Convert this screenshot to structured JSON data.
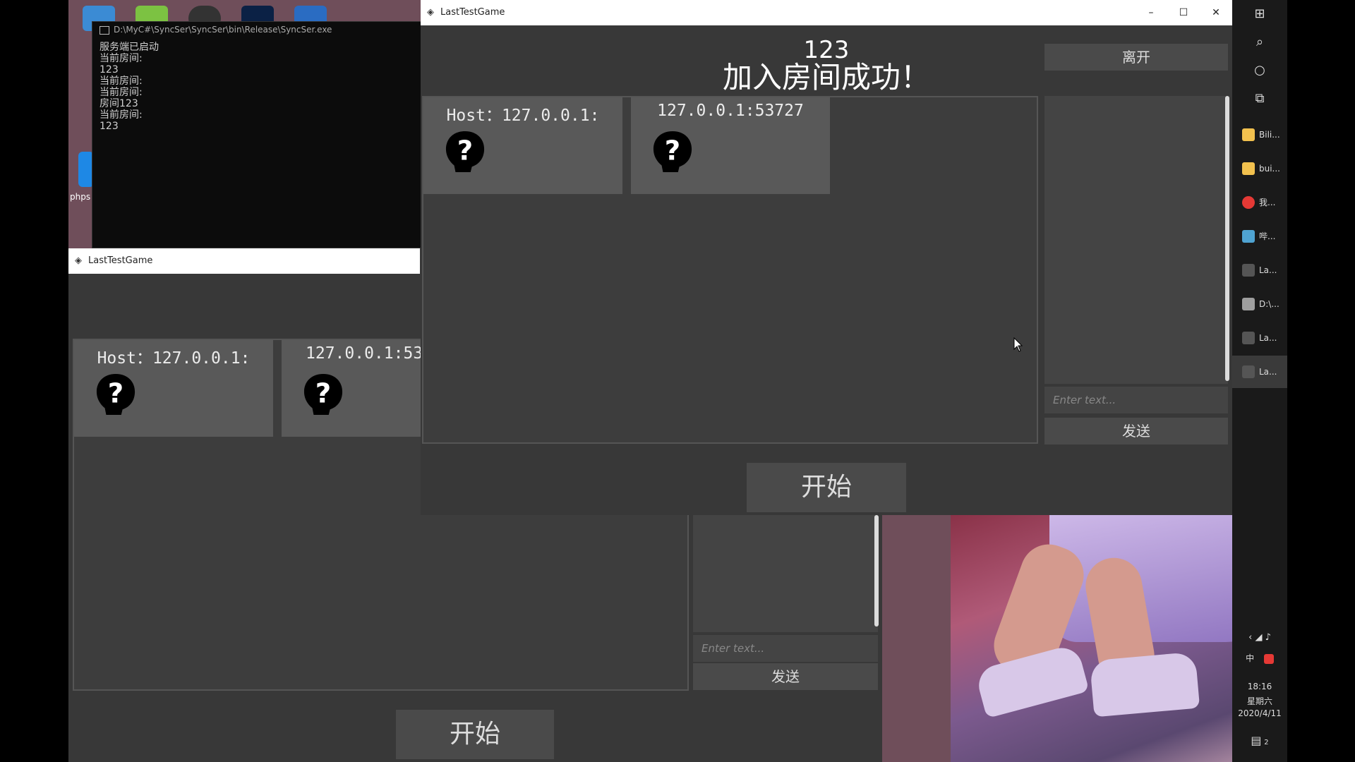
{
  "console": {
    "title": "D:\\MyC#\\SyncSer\\SyncSer\\bin\\Release\\SyncSer.exe",
    "lines": "服务端已启动\n当前房间:\n123\n当前房间:\n当前房间:\n房间123\n当前房间:\n123"
  },
  "back_window": {
    "title": "LastTestGame",
    "host_label": "Host：127.0.0.1:",
    "client_label": "127.0.0.1:53",
    "input_placeholder": "Enter text...",
    "send_label": "发送",
    "start_label": "开始"
  },
  "front_window": {
    "title": "LastTestGame",
    "room_number": "123",
    "status_text": "加入房间成功！",
    "leave_label": "离开",
    "host_label": "Host：127.0.0.1:",
    "client_label": "127.0.0.1:53727",
    "input_placeholder": "Enter text...",
    "send_label": "发送",
    "start_label": "开始",
    "minimize": "–",
    "maximize": "☐",
    "close": "✕"
  },
  "desktop_icons": [
    {
      "label": "phps",
      "color": "#1e88e5"
    }
  ],
  "taskbar": {
    "items": [
      {
        "label": "Bili...",
        "color": "#f2c14e"
      },
      {
        "label": "bui...",
        "color": "#f2c14e"
      },
      {
        "label": "我...",
        "color": "#e53935"
      },
      {
        "label": "哔...",
        "color": "#4fa3d1"
      },
      {
        "label": "La...",
        "color": "#555555"
      },
      {
        "label": "D:\\...",
        "color": "#9e9e9e"
      },
      {
        "label": "La...",
        "color": "#555555"
      },
      {
        "label": "La...",
        "color": "#555555"
      }
    ],
    "ime": "中",
    "time": "18:16",
    "weekday": "星期六",
    "date": "2020/4/11",
    "notifications": "2"
  }
}
